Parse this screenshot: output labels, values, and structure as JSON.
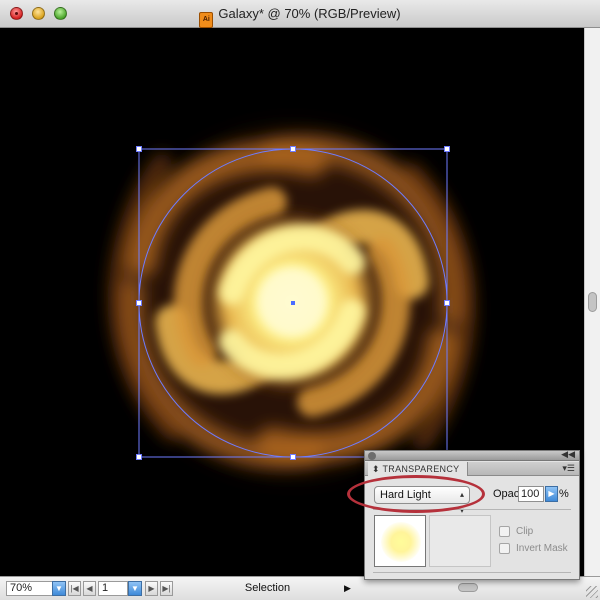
{
  "window": {
    "title": "Galaxy* @ 70% (RGB/Preview)",
    "app_icon_text": "Ai"
  },
  "colors": {
    "canvas_background": "#000000",
    "selection_blue": "#6f7cff",
    "annotation_red": "#b5313b",
    "galaxy_core": "#fff9a8",
    "galaxy_mid": "#e5b04a",
    "galaxy_outer": "#7a3a0f"
  },
  "statusbar": {
    "zoom_value": "70%",
    "page_value": "1",
    "tool_label": "Selection",
    "icons": [
      "dropdown-arrow-icon",
      "first-page-icon",
      "prev-page-icon",
      "next-page-icon",
      "last-page-icon",
      "status-menu-arrow-icon"
    ]
  },
  "transparency_panel": {
    "tab_label": "TRANSPARENCY",
    "blend_mode": "Hard Light",
    "opacity_label": "Opacity:",
    "opacity_value": "100",
    "opacity_unit": "%",
    "clip_label": "Clip",
    "invert_mask_label": "Invert Mask",
    "clip_checked": false,
    "invert_mask_checked": false
  }
}
